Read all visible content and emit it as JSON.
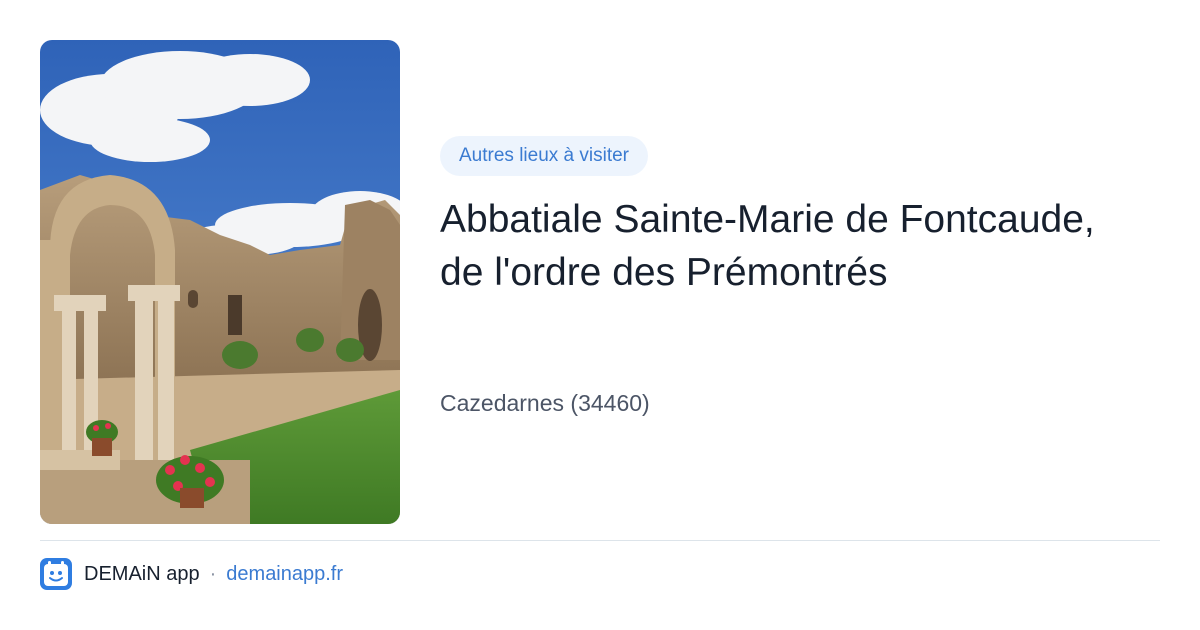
{
  "card": {
    "badge": "Autres lieux à visiter",
    "title": "Abbatiale Sainte-Marie de Fontcaude, de l'ordre des Prémontrés",
    "location": "Cazedarnes (34460)"
  },
  "footer": {
    "app_name": "DEMAiN app",
    "separator": "·",
    "domain": "demainapp.fr"
  },
  "colors": {
    "accent": "#3b7bd1",
    "badge_bg": "#edf4fd",
    "title": "#17202e",
    "muted": "#4c5566"
  }
}
